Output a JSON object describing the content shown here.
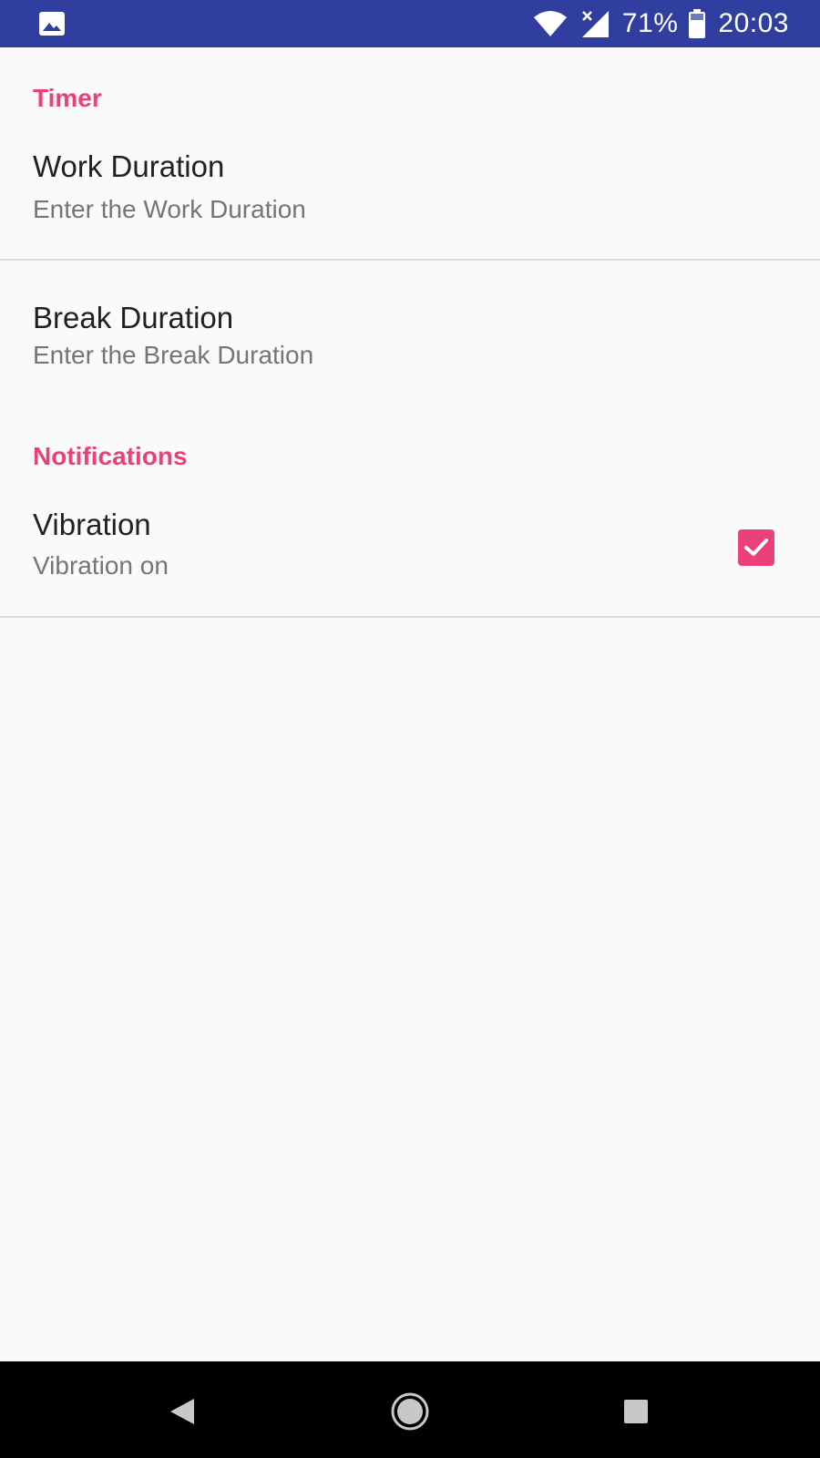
{
  "status_bar": {
    "battery_percent": "71%",
    "time": "20:03",
    "background_color": "#303f9f",
    "icons": [
      "image-icon",
      "wifi-icon",
      "signal-icon",
      "battery-icon"
    ]
  },
  "preferences": {
    "timer_category": "Timer",
    "work_duration": {
      "title": "Work Duration",
      "summary": "Enter the Work Duration"
    },
    "break_duration": {
      "title": "Break Duration",
      "summary": "Enter the Break Duration"
    },
    "notifications_category": "Notifications",
    "vibration": {
      "title": "Vibration",
      "summary": "Vibration on",
      "checked": true
    },
    "accent_color": "#ec407a"
  },
  "nav_bar": {
    "buttons": [
      "back-icon",
      "home-icon",
      "recents-icon"
    ]
  }
}
